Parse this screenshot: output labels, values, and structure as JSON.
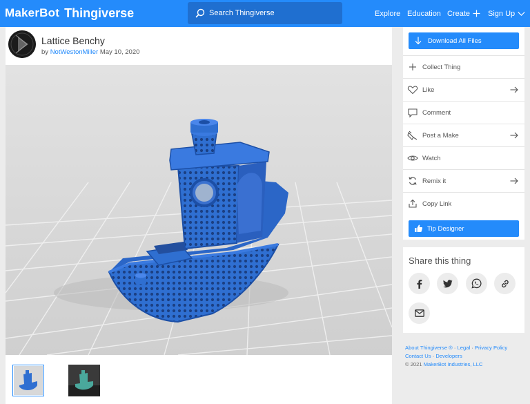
{
  "topbar": {
    "logo_makerbot": "MakerBot",
    "logo_thingiverse": "Thingiverse",
    "search_placeholder": "Search Thingiverse",
    "nav": {
      "explore": "Explore",
      "education": "Education",
      "create": "Create",
      "signup": "Sign Up"
    }
  },
  "thing": {
    "title": "Lattice Benchy",
    "by_prefix": "by",
    "author": "NotWestonMiller",
    "date": "May 10, 2020"
  },
  "sidebar": {
    "download_label": "Download All Files",
    "actions": [
      {
        "label": "Collect Thing",
        "icon": "plus-icon",
        "arrow": false
      },
      {
        "label": "Like",
        "icon": "heart-icon",
        "arrow": true
      },
      {
        "label": "Comment",
        "icon": "comment-icon",
        "arrow": false
      },
      {
        "label": "Post a Make",
        "icon": "post-make-icon",
        "arrow": true
      },
      {
        "label": "Watch",
        "icon": "eye-icon",
        "arrow": false
      },
      {
        "label": "Remix it",
        "icon": "remix-icon",
        "arrow": true
      },
      {
        "label": "Copy Link",
        "icon": "share-link-icon",
        "arrow": false
      }
    ],
    "tip_label": "Tip Designer"
  },
  "share": {
    "title": "Share this thing",
    "buttons": [
      "facebook-icon",
      "twitter-icon",
      "whatsapp-icon",
      "link-icon",
      "email-icon"
    ]
  },
  "footer": {
    "about": "About Thingiverse ®",
    "legal": "Legal",
    "privacy": "Privacy Policy",
    "contact": "Contact Us",
    "developers": "Developers",
    "copyright_prefix": "© 2021",
    "copyright_company": "MakerBot Industries, LLC",
    "separator": "·"
  },
  "colors": {
    "brand_blue": "#248bfb",
    "model_blue": "#2f6fd1"
  }
}
